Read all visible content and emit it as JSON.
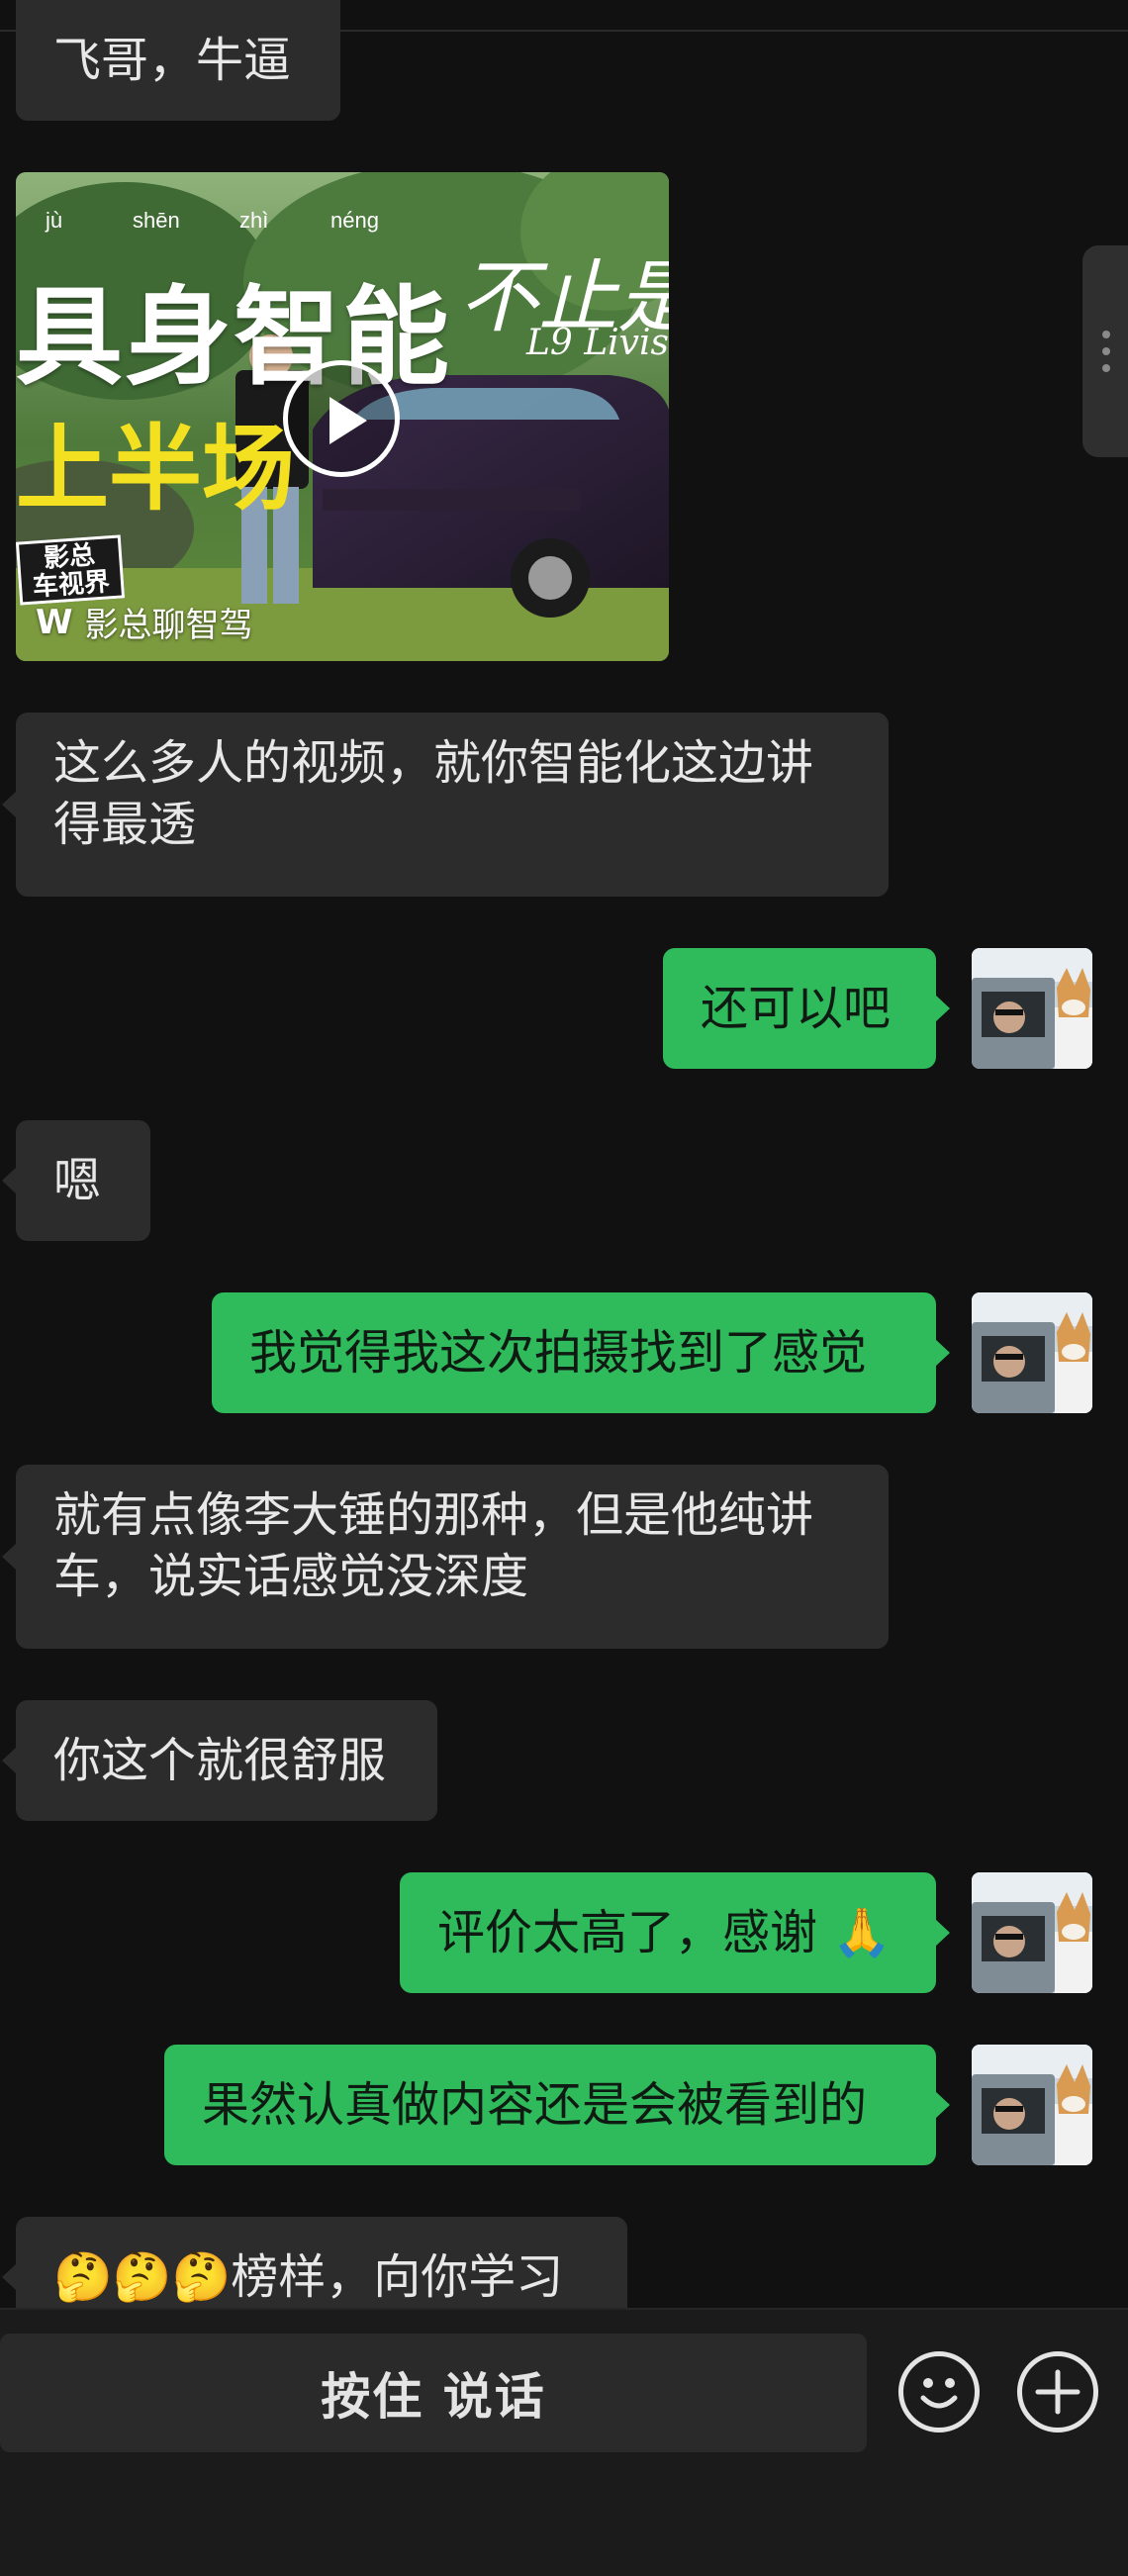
{
  "messages": [
    {
      "id": "m1",
      "side": "in",
      "text": "飞哥，牛逼"
    },
    {
      "id": "m2",
      "side": "in",
      "type": "video"
    },
    {
      "id": "m3",
      "side": "in",
      "text": "这么多人的视频，就你智能化这边讲\n得最透"
    },
    {
      "id": "m4",
      "side": "out",
      "text": "还可以吧"
    },
    {
      "id": "m5",
      "side": "in",
      "text": "嗯"
    },
    {
      "id": "m6",
      "side": "out",
      "text": "我觉得我这次拍摄找到了感觉"
    },
    {
      "id": "m7",
      "side": "in",
      "text": "就有点像李大锤的那种，但是他纯讲\n车，说实话感觉没深度"
    },
    {
      "id": "m8",
      "side": "in",
      "text": "你这个就很舒服"
    },
    {
      "id": "m9",
      "side": "out",
      "text": "评价太高了，感谢 🙏"
    },
    {
      "id": "m10",
      "side": "out",
      "text": "果然认真做内容还是会被看到的"
    },
    {
      "id": "m11",
      "side": "in",
      "text": "🤔🤔🤔榜样，向你学习"
    }
  ],
  "video": {
    "title": "具身智能",
    "pinyin": [
      "jù",
      "shēn",
      "zhì",
      "néng"
    ],
    "subtitle": "上半场",
    "script_title": "不止是车",
    "model": "L9 Livis",
    "badge": "影总\n车视界",
    "channel": "影总聊智驾",
    "play_icon": "play-icon"
  },
  "input_bar": {
    "hold_to_talk": "按住 说话",
    "emoji_icon": "smiley-icon",
    "plus_icon": "plus-icon"
  },
  "colors": {
    "background": "#111111",
    "incoming_bubble": "#2c2c2c",
    "outgoing_bubble": "#2fba5c"
  }
}
